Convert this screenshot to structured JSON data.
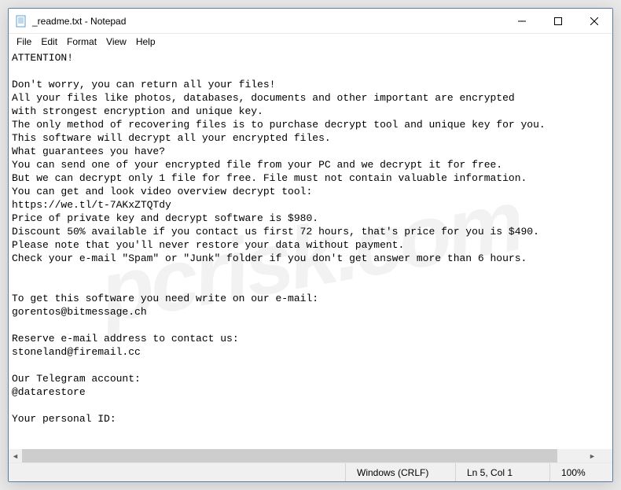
{
  "window": {
    "title": "_readme.txt - Notepad"
  },
  "menu": {
    "file": "File",
    "edit": "Edit",
    "format": "Format",
    "view": "View",
    "help": "Help"
  },
  "content": {
    "text": "ATTENTION!\n\nDon't worry, you can return all your files!\nAll your files like photos, databases, documents and other important are encrypted\nwith strongest encryption and unique key.\nThe only method of recovering files is to purchase decrypt tool and unique key for you.\nThis software will decrypt all your encrypted files.\nWhat guarantees you have?\nYou can send one of your encrypted file from your PC and we decrypt it for free.\nBut we can decrypt only 1 file for free. File must not contain valuable information.\nYou can get and look video overview decrypt tool:\nhttps://we.tl/t-7AKxZTQTdy\nPrice of private key and decrypt software is $980.\nDiscount 50% available if you contact us first 72 hours, that's price for you is $490.\nPlease note that you'll never restore your data without payment.\nCheck your e-mail \"Spam\" or \"Junk\" folder if you don't get answer more than 6 hours.\n\n\nTo get this software you need write on our e-mail:\ngorentos@bitmessage.ch\n\nReserve e-mail address to contact us:\nstoneland@firemail.cc\n\nOur Telegram account:\n@datarestore\n\nYour personal ID:\n"
  },
  "status": {
    "eol": "Windows (CRLF)",
    "cursor": "Ln 5, Col 1",
    "zoom": "100%"
  },
  "watermark": "pcrisk.com"
}
